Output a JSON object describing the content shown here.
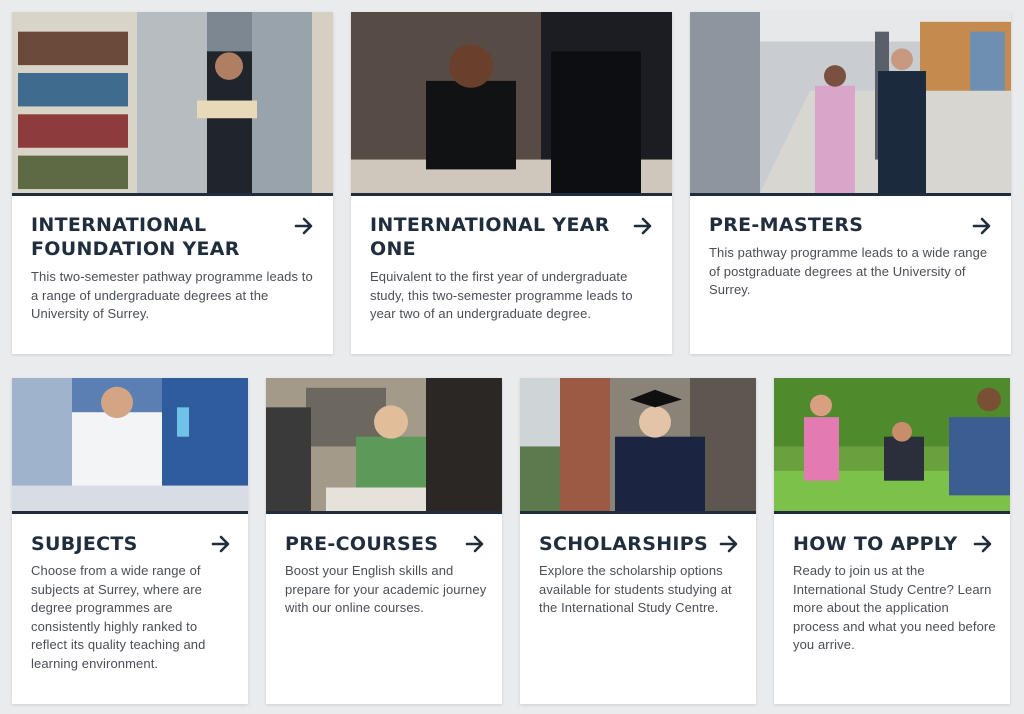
{
  "cards": [
    {
      "title": "INTERNATIONAL FOUNDATION YEAR",
      "description": "This two-semester pathway programme leads to a range of undergraduate degrees at the University of Surrey.",
      "image": "library-student-photo"
    },
    {
      "title": "INTERNATIONAL YEAR ONE",
      "description": "Equivalent to the first year of undergraduate study, this two-semester programme leads to year two of an undergraduate degree.",
      "image": "student-writing-photo"
    },
    {
      "title": "PRE-MASTERS",
      "description": "This pathway programme leads to a wide range of postgraduate degrees at the University of Surrey.",
      "image": "campus-walkway-photo"
    },
    {
      "title": "SUBJECTS",
      "description": "Choose from a wide range of subjects at Surrey, where are degree programmes are consistently highly ranked to reflect its quality teaching and learning environment.",
      "image": "laboratory-photo"
    },
    {
      "title": "PRE-COURSES",
      "description": "Boost your English skills and prepare for your academic journey with our online courses.",
      "image": "study-group-photo"
    },
    {
      "title": "SCHOLARSHIPS",
      "description": "Explore the scholarship options available for students studying at the International Study Centre.",
      "image": "graduate-photo"
    },
    {
      "title": "HOW TO APPLY",
      "description": "Ready to join us at the International Study Centre? Learn more about the application process and what you need before you arrive.",
      "image": "students-on-lawn-photo"
    }
  ],
  "colors": {
    "page_background": "#eaebed",
    "card_background": "#ffffff",
    "heading": "#1f2d3d",
    "body_text": "#4a4f55",
    "accent_bar": "#1f2d3d"
  },
  "icons": {
    "card_link": "arrow-right-icon"
  }
}
